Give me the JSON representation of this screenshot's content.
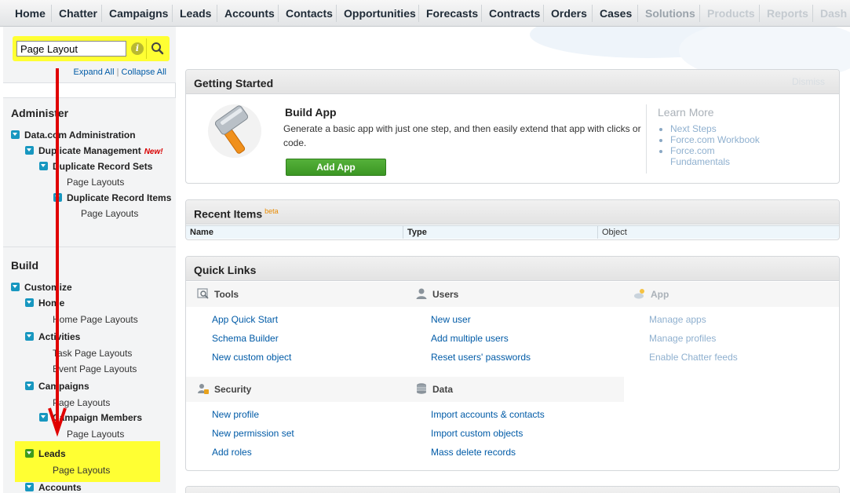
{
  "nav": {
    "tabs": [
      "Home",
      "Chatter",
      "Campaigns",
      "Leads",
      "Accounts",
      "Contacts",
      "Opportunities",
      "Forecasts",
      "Contracts",
      "Orders",
      "Cases",
      "Solutions",
      "Products",
      "Reports",
      "Dash"
    ]
  },
  "sidebar": {
    "search_value": "Page Layout",
    "expand_all": "Expand All",
    "collapse_all": "Collapse All",
    "separator": "|",
    "administer": {
      "title": "Administer",
      "items": {
        "datacom": "Data.com Administration",
        "dup_mgmt": "Duplicate Management",
        "new_badge": "New!",
        "dup_sets": "Duplicate Record Sets",
        "dup_sets_layouts": "Page Layouts",
        "dup_items": "Duplicate Record Items",
        "dup_items_layouts": "Page Layouts"
      }
    },
    "build": {
      "title": "Build",
      "items": {
        "customize": "Customize",
        "home": "Home",
        "home_layouts": "Home Page Layouts",
        "activities": "Activities",
        "task_layouts": "Task Page Layouts",
        "event_layouts": "Event Page Layouts",
        "campaigns": "Campaigns",
        "campaigns_layouts": "Page Layouts",
        "campaign_members": "Campaign Members",
        "campaign_members_layouts": "Page Layouts",
        "leads": "Leads",
        "leads_layouts": "Page Layouts",
        "accounts": "Accounts"
      }
    }
  },
  "getting_started": {
    "title": "Getting Started",
    "dismiss": "Dismiss",
    "build_app_title": "Build App",
    "build_app_desc": "Generate a basic app with just one step, and then easily extend that app with clicks or code.",
    "add_app_button": "Add App",
    "learn_more_title": "Learn More",
    "learn_more_links": [
      "Next Steps",
      "Force.com Workbook",
      "Force.com",
      "Fundamentals"
    ]
  },
  "recent_items": {
    "title": "Recent Items",
    "beta": "beta",
    "columns": [
      "Name",
      "Type",
      "Object"
    ]
  },
  "quick_links": {
    "title": "Quick Links",
    "tools": {
      "title": "Tools",
      "links": [
        "App Quick Start",
        "Schema Builder",
        "New custom object"
      ]
    },
    "users": {
      "title": "Users",
      "links": [
        "New user",
        "Add multiple users",
        "Reset users' passwords"
      ]
    },
    "app": {
      "title": "App",
      "links": [
        "Manage apps",
        "Manage profiles",
        "Enable Chatter feeds"
      ]
    },
    "security": {
      "title": "Security",
      "links": [
        "New profile",
        "New permission set",
        "Add roles"
      ]
    },
    "data": {
      "title": "Data",
      "links": [
        "Import accounts & contacts",
        "Import custom objects",
        "Mass delete records"
      ]
    }
  },
  "colors": {
    "accent_link": "#015ba7",
    "highlight": "#ffff33",
    "arrow": "#e00000",
    "add_button": "#3b9623"
  }
}
